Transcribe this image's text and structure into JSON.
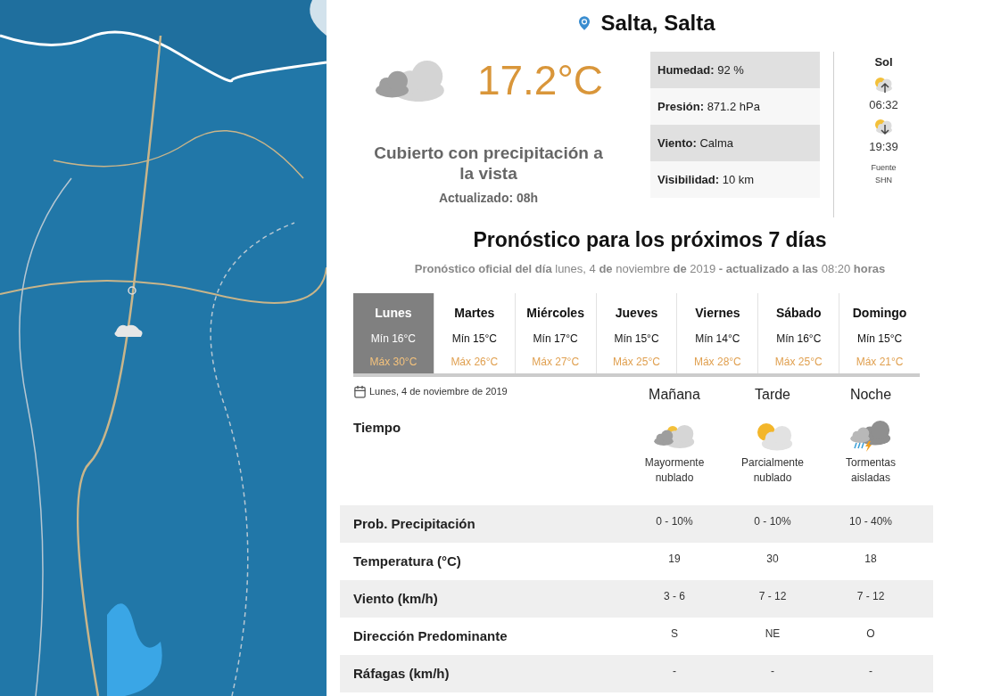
{
  "location": {
    "name": "Salta, Salta"
  },
  "current": {
    "kind": "overcast",
    "temperature": "17.2°C",
    "description": "Cubierto con precipitación a la vista",
    "updated": "Actualizado: 08h"
  },
  "stats": [
    {
      "label": "Humedad:",
      "value": "92 %"
    },
    {
      "label": "Presión:",
      "value": "871.2 hPa"
    },
    {
      "label": "Viento:",
      "value": "Calma"
    },
    {
      "label": "Visibilidad:",
      "value": "10 km"
    }
  ],
  "sun": {
    "title": "Sol",
    "events": [
      {
        "kind": "sunrise",
        "time": "06:32"
      },
      {
        "kind": "sunset",
        "time": "19:39"
      }
    ],
    "source": "Fuente SHN"
  },
  "forecast": {
    "title": "Pronóstico para los próximos 7 días",
    "subtitle": "**Pronóstico oficial del día** lunes, 4 **de** noviembre **de** 2019 **- actualizado a las** 08:20 **horas**",
    "days": [
      {
        "name": "Lunes",
        "min": "Mín 16°C",
        "max": "Máx 30°C",
        "selected": true
      },
      {
        "name": "Martes",
        "min": "Mín 15°C",
        "max": "Máx 26°C",
        "selected": false
      },
      {
        "name": "Miércoles",
        "min": "Mín 17°C",
        "max": "Máx 27°C",
        "selected": false
      },
      {
        "name": "Jueves",
        "min": "Mín 15°C",
        "max": "Máx 25°C",
        "selected": false
      },
      {
        "name": "Viernes",
        "min": "Mín 14°C",
        "max": "Máx 28°C",
        "selected": false
      },
      {
        "name": "Sábado",
        "min": "Mín 16°C",
        "max": "Máx 25°C",
        "selected": false
      },
      {
        "name": "Domingo",
        "min": "Mín 15°C",
        "max": "Máx 21°C",
        "selected": false
      }
    ]
  },
  "detail": {
    "date": "Lunes, 4 de noviembre de 2019",
    "weather_label": "Tiempo",
    "periods": [
      {
        "name": "Mañana",
        "kind": "mostly_cloudy",
        "condition": "Mayormente nublado"
      },
      {
        "name": "Tarde",
        "kind": "partly_cloudy",
        "condition": "Parcialmente nublado"
      },
      {
        "name": "Noche",
        "kind": "storm",
        "condition": "Tormentas aisladas"
      }
    ],
    "rows": [
      {
        "label": "Prob. Precipitación",
        "values": [
          "0 - 10%",
          "0 - 10%",
          "10 - 40%"
        ]
      },
      {
        "label": "Temperatura (°C)",
        "values": [
          "19",
          "30",
          "18"
        ]
      },
      {
        "label": "Viento (km/h)",
        "values": [
          "3 - 6",
          "7 - 12",
          "7 - 12"
        ]
      },
      {
        "label": "Dirección Predominante",
        "values": [
          "S",
          "NE",
          "O"
        ]
      },
      {
        "label": "Ráfagas (km/h)",
        "values": [
          "-",
          "-",
          "-"
        ]
      }
    ]
  }
}
